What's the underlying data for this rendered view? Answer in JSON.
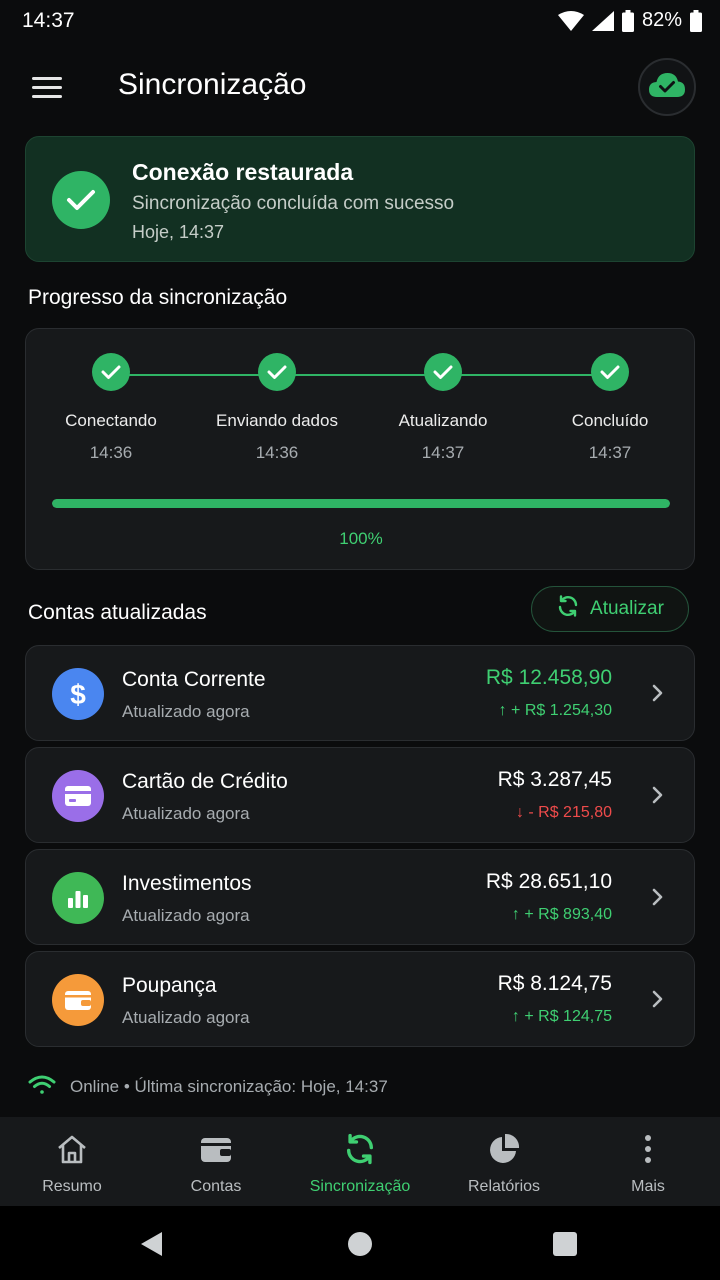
{
  "status_bar": {
    "time": "14:37",
    "battery": "82%"
  },
  "app_bar": {
    "title": "Sincronização"
  },
  "banner": {
    "title": "Conexão restaurada",
    "subtitle": "Sincronização concluída com sucesso",
    "time": "Hoje, 14:37"
  },
  "progress": {
    "section_title": "Progresso da sincronização",
    "steps": [
      {
        "label": "Conectando",
        "time": "14:36"
      },
      {
        "label": "Enviando dados",
        "time": "14:36"
      },
      {
        "label": "Atualizando",
        "time": "14:37"
      },
      {
        "label": "Concluído",
        "time": "14:37"
      }
    ],
    "percent_label": "100%",
    "percent_value": 100
  },
  "accounts": {
    "section_title": "Contas atualizadas",
    "refresh_label": "Atualizar",
    "items": [
      {
        "name": "Conta Corrente",
        "status": "Atualizado agora",
        "amount": "R$ 12.458,90",
        "delta": "↑ + R$ 1.254,30",
        "icon": "dollar-icon",
        "color": "#4a86f0"
      },
      {
        "name": "Cartão de Crédito",
        "status": "Atualizado agora",
        "amount": "R$ 3.287,45",
        "delta": "↓ - R$ 215,80",
        "icon": "credit-card-icon",
        "color": "#9a6ee8"
      },
      {
        "name": "Investimentos",
        "status": "Atualizado agora",
        "amount": "R$ 28.651,10",
        "delta": "↑ + R$ 893,40",
        "icon": "bar-chart-icon",
        "color": "#3fb856"
      },
      {
        "name": "Poupança",
        "status": "Atualizado agora",
        "amount": "R$ 8.124,75",
        "delta": "↑ + R$ 124,75",
        "icon": "wallet-icon",
        "color": "#f59a3a"
      }
    ]
  },
  "footer": {
    "online_text": "Online • Última sincronização: Hoje, 14:37"
  },
  "bottom_nav": {
    "items": [
      {
        "label": "Resumo",
        "icon": "home-icon"
      },
      {
        "label": "Contas",
        "icon": "wallet-icon"
      },
      {
        "label": "Sincronização",
        "icon": "sync-icon",
        "active": true
      },
      {
        "label": "Relatórios",
        "icon": "pie-chart-icon"
      },
      {
        "label": "Mais",
        "icon": "more-vertical-icon"
      }
    ]
  },
  "colors": {
    "accent": "#2fb465",
    "accent_text": "#3fcf72",
    "negative": "#ee4b4b",
    "background": "#0b0c0d",
    "card": "#17191b"
  }
}
